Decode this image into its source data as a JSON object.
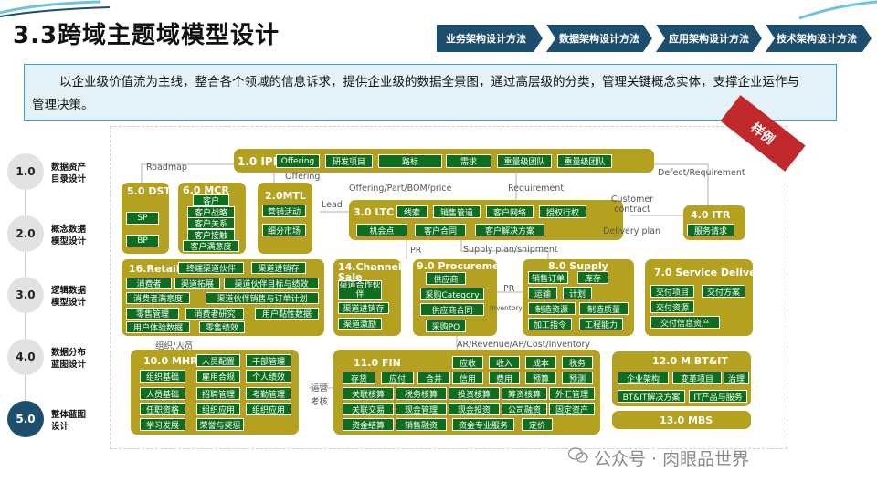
{
  "header": {
    "title": "3.3跨域主题域模型设计",
    "nav": [
      "业务架构设计方法",
      "数据架构设计方法",
      "应用架构设计方法",
      "技术架构设计方法"
    ]
  },
  "banner": {
    "line1": "以企业级价值流为主线，整合各个领域的信息诉求，提供企业级的数据全景图，通过高层级的分类，管理关键概念实体，支撑企业运作与",
    "line2": "管理决策。"
  },
  "steps": [
    {
      "num": "1.0",
      "line1": "数据资产",
      "line2": "目录设计"
    },
    {
      "num": "2.0",
      "line1": "概念数据",
      "line2": "模型设计"
    },
    {
      "num": "3.0",
      "line1": "逻辑数据",
      "line2": "模型设计"
    },
    {
      "num": "4.0",
      "line1": "数据分布",
      "line2": "蓝图设计"
    },
    {
      "num": "5.0",
      "line1": "整体蓝图",
      "line2": "设计"
    }
  ],
  "stamp": "样例",
  "ipd": {
    "title": "1.0 IPD",
    "items": [
      "Offering",
      "研发项目",
      "路标",
      "需求",
      "重量级团队",
      "重量级团队"
    ]
  },
  "dst": {
    "title": "5.0 DST",
    "items": [
      "SP",
      "BP"
    ]
  },
  "mcr": {
    "title": "6.0 MCR",
    "items": [
      "客户",
      "客户战略",
      "客户关系",
      "客户接触",
      "客户满意度"
    ]
  },
  "mtl": {
    "title": "2.0MTL",
    "items": [
      "营销活动",
      "细分市场"
    ]
  },
  "ltc": {
    "title": "3.0 LTC",
    "items": [
      "线索",
      "销售管道",
      "客户网络",
      "授权行权",
      "机会点",
      "客户合同",
      "客户解决方案"
    ]
  },
  "itr": {
    "title": "4.0 ITR",
    "items": [
      "服务请求"
    ]
  },
  "retail": {
    "title": "16.Retail",
    "items": [
      "终端渠道伙伴",
      "渠道进销存",
      "消费者",
      "渠道拓展",
      "渠道伙伴目标与绩效",
      "消费者满意度",
      "渠道伙伴销售与订单计划",
      "零售管理",
      "消费者研究",
      "用户黏性数据",
      "用户体验数据",
      "零售绩效"
    ]
  },
  "channel": {
    "title": "14.Channel Sale",
    "items": [
      "渠道合作伙伴",
      "渠道进销存",
      "渠道激励"
    ]
  },
  "procurement": {
    "title": "9.0 Procurement",
    "items": [
      "供应商",
      "采购Category",
      "供应商合同",
      "采购PO"
    ]
  },
  "supply": {
    "title": "8.0 Supply",
    "items": [
      "销售订单",
      "库存",
      "运输",
      "计划",
      "制造资源",
      "制造质量",
      "加工指令",
      "工程能力"
    ]
  },
  "service": {
    "title": "7.0 Service Delivery",
    "items": [
      "交付项目",
      "交付方案",
      "交付资源",
      "交付信息资产"
    ]
  },
  "mhr": {
    "title": "10.0 MHR",
    "items": [
      "人员配置",
      "干部管理",
      "组织基础",
      "雇用合规",
      "个人绩效",
      "人员基础",
      "招聘管理",
      "考勤管理",
      "任职资格",
      "组织应用",
      "组织应用",
      "学习发展",
      "荣誉与奖惩"
    ]
  },
  "fin": {
    "title": "11.0 FIN",
    "items": [
      "应收",
      "收入",
      "成本",
      "税务",
      "存货",
      "应付",
      "合并",
      "信用",
      "费用",
      "预算",
      "预测",
      "关联核算",
      "税务核算",
      "投资核算",
      "筹资核算",
      "外汇管理",
      "关联交易",
      "现金管理",
      "现金投资",
      "公司融资",
      "固定资产",
      "资金结算",
      "销售融资",
      "资金专业服务",
      "定价"
    ]
  },
  "btit": {
    "title": "12.0 M BT&IT",
    "items": [
      "企业架构",
      "变革项目",
      "治理",
      "BT&IT解决方案",
      "IT产品与服务"
    ]
  },
  "mbs": {
    "title": "13.0 MBS"
  },
  "labels": {
    "roadmap": "Roadmap",
    "offering": "Offering",
    "defect": "Defect/Requirement",
    "lead": "Lead",
    "offering_part": "Offering/Part/BOM/price",
    "requirement": "Requirement",
    "customer_contract": "Customer contract",
    "delivery_plan": "Delivery plan",
    "pr1": "PR",
    "supply_plan": "Supply plan/shipment",
    "pr2": "PR",
    "inventory": "Inventory",
    "org_people": "组织/人员",
    "ar": "AR/Revenue/AP/Cost/Inventory",
    "ops1": "运营",
    "ops2": "考核"
  },
  "watermark": "公众号 · 肉眼品世界",
  "colors": {
    "box": "#b4a11f",
    "item": "#0f6e1e",
    "nav": "#1d4e6e",
    "stamp": "#c0282b",
    "banner_border": "#3aa1c5"
  }
}
